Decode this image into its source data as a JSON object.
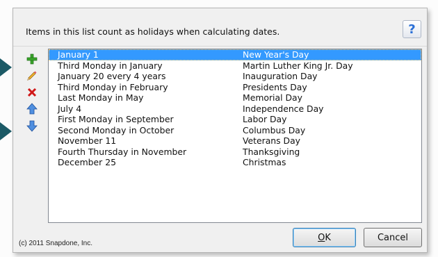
{
  "header": {
    "text": "Items in this list count as holidays when calculating dates.",
    "help_label": "?"
  },
  "toolbar": {
    "icons": [
      "add-icon",
      "edit-icon",
      "delete-icon",
      "move-up-icon",
      "move-down-icon"
    ]
  },
  "holidays": [
    {
      "rule": "January 1",
      "name": "New Year's Day"
    },
    {
      "rule": "Third Monday in January",
      "name": "Martin Luther King Jr. Day"
    },
    {
      "rule": "January 20 every 4 years",
      "name": "Inauguration Day"
    },
    {
      "rule": "Third Monday in February",
      "name": "Presidents Day"
    },
    {
      "rule": "Last Monday in May",
      "name": "Memorial Day"
    },
    {
      "rule": "July 4",
      "name": "Independence Day"
    },
    {
      "rule": "First Monday in September",
      "name": "Labor Day"
    },
    {
      "rule": "Second Monday in October",
      "name": "Columbus Day"
    },
    {
      "rule": "November 11",
      "name": "Veterans Day"
    },
    {
      "rule": "Fourth Thursday in November",
      "name": "Thanksgiving"
    },
    {
      "rule": "December 25",
      "name": "Christmas"
    }
  ],
  "selected_index": 0,
  "footer": {
    "copyright": "(c) 2011 Snapdone, Inc.",
    "ok_label": "OK",
    "cancel_label": "Cancel"
  },
  "colors": {
    "selection": "#3399ff",
    "annotation_arrow": "#1c5a66"
  }
}
